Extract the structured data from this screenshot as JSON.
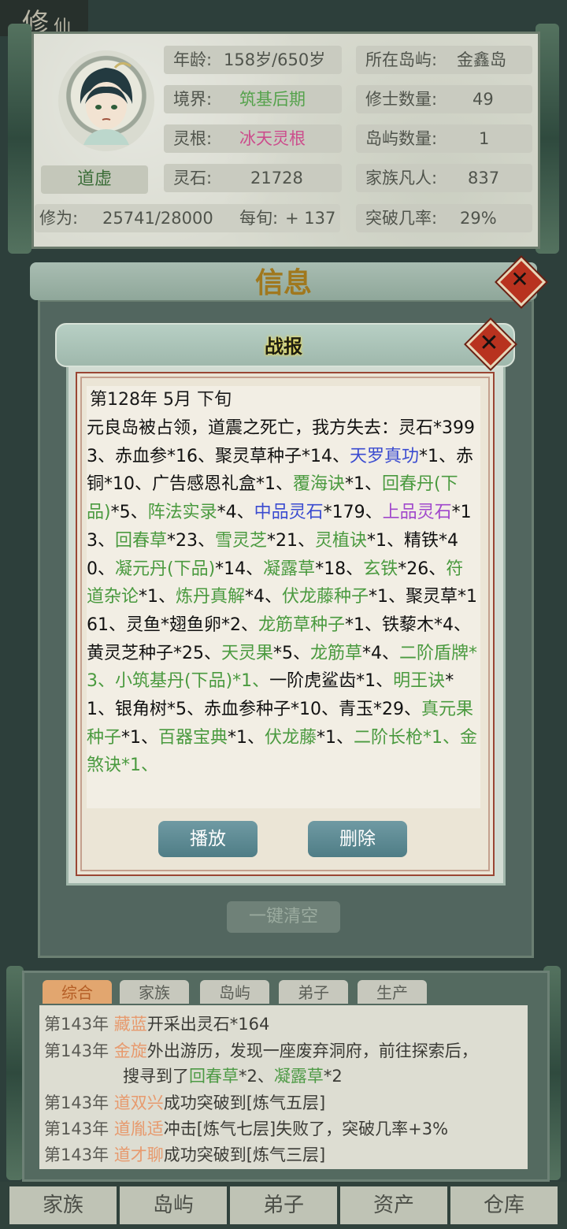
{
  "corner_tag": {
    "main": "修",
    "sub": "仙"
  },
  "profile": {
    "name": "道虚",
    "age_label": "年龄:",
    "age_value": "158岁/650岁",
    "island_label": "所在岛屿:",
    "island_value": "金鑫岛",
    "realm_label": "境界:",
    "realm_value": "筑基后期",
    "cultivators_label": "修士数量:",
    "cultivators_value": "49",
    "root_label": "灵根:",
    "root_value": "冰天灵根",
    "islands_label": "岛屿数量:",
    "islands_value": "1",
    "stone_label": "灵石:",
    "stone_value": "21728",
    "mortals_label": "家族凡人:",
    "mortals_value": "837",
    "xiuwei_label": "修为:",
    "xiuwei_value": "25741/28000",
    "per_turn_label": "每旬:",
    "per_turn_value": "+ 137",
    "breakthrough_label": "突破几率:",
    "breakthrough_value": "29%"
  },
  "info_panel": {
    "title": "信息",
    "clear_button": "一键清空"
  },
  "dialog": {
    "title": "战报",
    "date": "第128年 5月 下旬",
    "play_button": "播放",
    "delete_button": "删除"
  },
  "report_segments": [
    {
      "t": "元良岛被占领，道震之死亡，我方失去：灵石*3993、赤血参*16、聚灵草种子*14、",
      "c": ""
    },
    {
      "t": "天罗真功",
      "c": "b"
    },
    {
      "t": "*1、赤铜*10、广告感恩礼盒*1、",
      "c": ""
    },
    {
      "t": "覆海诀",
      "c": "g"
    },
    {
      "t": "*1、",
      "c": ""
    },
    {
      "t": "回春丹(下品)",
      "c": "g"
    },
    {
      "t": "*5、",
      "c": ""
    },
    {
      "t": "阵法实录",
      "c": "g"
    },
    {
      "t": "*4、",
      "c": ""
    },
    {
      "t": "中品灵石",
      "c": "b"
    },
    {
      "t": "*179、",
      "c": ""
    },
    {
      "t": "上品灵石",
      "c": "p"
    },
    {
      "t": "*13、",
      "c": ""
    },
    {
      "t": "回春草",
      "c": "g"
    },
    {
      "t": "*23、",
      "c": ""
    },
    {
      "t": "雪灵芝",
      "c": "g"
    },
    {
      "t": "*21、",
      "c": ""
    },
    {
      "t": "灵植诀",
      "c": "g"
    },
    {
      "t": "*1、精铁*40、",
      "c": ""
    },
    {
      "t": "凝元丹(下品)",
      "c": "g"
    },
    {
      "t": "*14、",
      "c": ""
    },
    {
      "t": "凝露草",
      "c": "g"
    },
    {
      "t": "*18、",
      "c": ""
    },
    {
      "t": "玄铁",
      "c": "g"
    },
    {
      "t": "*26、",
      "c": ""
    },
    {
      "t": "符道杂论",
      "c": "g"
    },
    {
      "t": "*1、",
      "c": ""
    },
    {
      "t": "炼丹真解",
      "c": "g"
    },
    {
      "t": "*4、",
      "c": ""
    },
    {
      "t": "伏龙藤种子",
      "c": "g"
    },
    {
      "t": "*1、聚灵草*161、灵鱼*翅鱼卵*2、",
      "c": ""
    },
    {
      "t": "龙筋草种子",
      "c": "g"
    },
    {
      "t": "*1、铁藜木*4、黄灵芝种子*25、",
      "c": ""
    },
    {
      "t": "天灵果",
      "c": "g"
    },
    {
      "t": "*5、",
      "c": ""
    },
    {
      "t": "龙筋草",
      "c": "g"
    },
    {
      "t": "*4、",
      "c": ""
    },
    {
      "t": "二阶盾牌*3、小筑基丹(下品)*1、",
      "c": "g"
    },
    {
      "t": "一阶虎鲨齿*1、",
      "c": ""
    },
    {
      "t": "明王诀",
      "c": "g"
    },
    {
      "t": "*1、银角树*5、赤血参种子*10、青玉*29、",
      "c": ""
    },
    {
      "t": "真元果种子",
      "c": "g"
    },
    {
      "t": "*1、",
      "c": ""
    },
    {
      "t": "百器宝典",
      "c": "g"
    },
    {
      "t": "*1、",
      "c": ""
    },
    {
      "t": "伏龙藤",
      "c": "g"
    },
    {
      "t": "*1、",
      "c": ""
    },
    {
      "t": "二阶长枪*1、金煞诀*1、",
      "c": "g"
    }
  ],
  "log_tabs": [
    "综合",
    "家族",
    "岛屿",
    "弟子",
    "生产"
  ],
  "log_entries": [
    {
      "year": "第143年",
      "name": "藏蓝",
      "pre": "开采出灵石*164",
      "line2": ""
    },
    {
      "year": "第143年",
      "name": "金旋",
      "pre": "外出游历，发现一座废弃洞府，前往探索后，",
      "line2": "搜寻到了"
    },
    {
      "year": "第143年",
      "name": "道双兴",
      "pre": "成功突破到[炼气五层]",
      "line2": ""
    },
    {
      "year": "第143年",
      "name": "道胤适",
      "pre": "冲击[炼气七层]失败了，突破几率+3%",
      "line2": ""
    },
    {
      "year": "第143年",
      "name": "道才聊",
      "pre": "成功突破到[炼气三层]",
      "line2": ""
    }
  ],
  "log_find": [
    {
      "t": "回春草",
      "c": "g"
    },
    {
      "t": "*2、",
      "c": ""
    },
    {
      "t": "凝露草",
      "c": "g"
    },
    {
      "t": "*2",
      "c": ""
    }
  ],
  "nav": [
    "家族",
    "岛屿",
    "弟子",
    "资产",
    "仓库"
  ]
}
